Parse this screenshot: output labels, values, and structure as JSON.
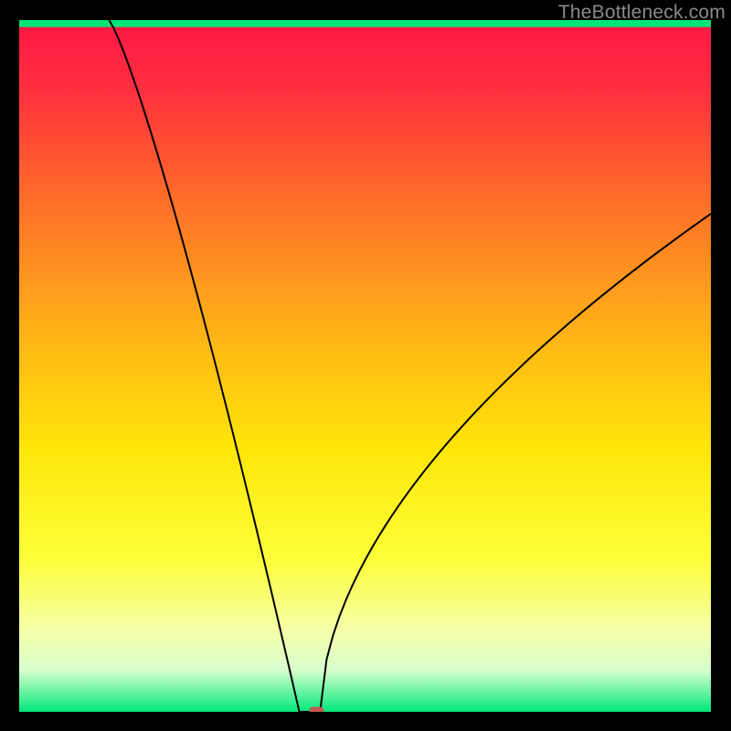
{
  "watermark": "TheBottleneck.com",
  "chart_data": {
    "type": "line",
    "title": "",
    "xlabel": "",
    "ylabel": "",
    "xlim": [
      0,
      100
    ],
    "ylim": [
      0,
      100
    ],
    "grid": false,
    "legend": false,
    "curve": {
      "optimum_x": 42,
      "left_start_y": 100,
      "left_start_x": 13,
      "right_end_y": 72,
      "right_end_x": 100,
      "floor_y": 0,
      "floor_width": 3
    },
    "marker": {
      "x": 43,
      "y": 0,
      "color": "#c35a52",
      "shape": "rounded-rect"
    },
    "gradient_stops": [
      {
        "pos": 0.0,
        "color": "#ff1744"
      },
      {
        "pos": 0.1,
        "color": "#ff2f3f"
      },
      {
        "pos": 0.25,
        "color": "#ff6a2a"
      },
      {
        "pos": 0.45,
        "color": "#ffb217"
      },
      {
        "pos": 0.62,
        "color": "#ffe609"
      },
      {
        "pos": 0.78,
        "color": "#fdff3a"
      },
      {
        "pos": 0.88,
        "color": "#f5ffa6"
      },
      {
        "pos": 0.94,
        "color": "#d8ffce"
      },
      {
        "pos": 1.0,
        "color": "#00e97a"
      }
    ],
    "bottom_band": {
      "from_y": 99.0,
      "to_y": 100,
      "color": "#00e676"
    }
  }
}
